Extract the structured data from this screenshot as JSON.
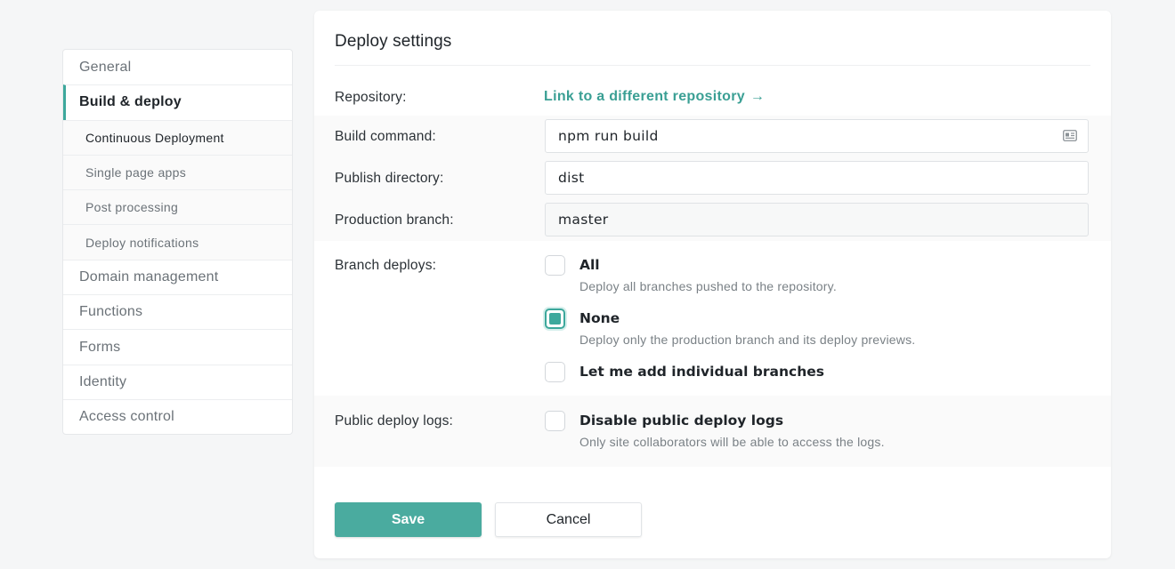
{
  "sidebar": {
    "items": [
      {
        "label": "General"
      },
      {
        "label": "Build & deploy"
      },
      {
        "label": "Domain management"
      },
      {
        "label": "Functions"
      },
      {
        "label": "Forms"
      },
      {
        "label": "Identity"
      },
      {
        "label": "Access control"
      }
    ],
    "sub_items": [
      {
        "label": "Continuous Deployment"
      },
      {
        "label": "Single page apps"
      },
      {
        "label": "Post processing"
      },
      {
        "label": "Deploy notifications"
      }
    ]
  },
  "main": {
    "title": "Deploy settings",
    "repository": {
      "label": "Repository:",
      "link": "Link to a different repository",
      "arrow": "→"
    },
    "build_command": {
      "label": "Build command:",
      "value": "npm run build"
    },
    "publish_directory": {
      "label": "Publish directory:",
      "value": "dist"
    },
    "production_branch": {
      "label": "Production branch:",
      "value": "master"
    },
    "branch_deploys": {
      "label": "Branch deploys:",
      "options": [
        {
          "title": "All",
          "desc": "Deploy all branches pushed to the repository.",
          "checked": false
        },
        {
          "title": "None",
          "desc": "Deploy only the production branch and its deploy previews.",
          "checked": true
        },
        {
          "title": "Let me add individual branches",
          "desc": "",
          "checked": false
        }
      ]
    },
    "public_deploy_logs": {
      "label": "Public deploy logs:",
      "option": {
        "title": "Disable public deploy logs",
        "desc": "Only site collaborators will be able to access the logs.",
        "checked": false
      }
    },
    "save_label": "Save",
    "cancel_label": "Cancel"
  },
  "colors": {
    "accent": "#3da89c",
    "link": "#3a9f94",
    "save_button": "#4aab9f",
    "background": "#f5f6f7"
  }
}
